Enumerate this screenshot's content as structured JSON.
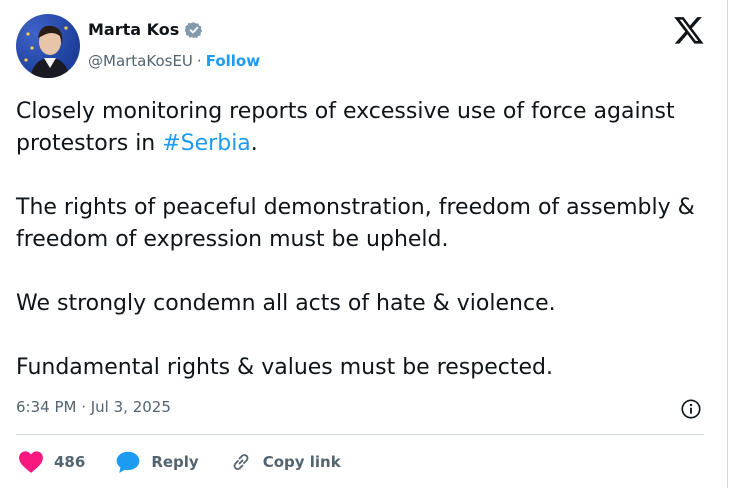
{
  "author": {
    "name": "Marta Kos",
    "handle": "@MartaKosEU",
    "separator": "·",
    "follow_label": "Follow"
  },
  "tweet": {
    "line1_prefix": "Closely monitoring reports of excessive use of force against protestors in ",
    "hashtag": "#Serbia",
    "line1_suffix": ".",
    "para2": "The rights of peaceful demonstration, freedom of assembly & freedom of expression must be upheld.",
    "para3": "We strongly condemn all acts of hate & violence.",
    "para4": "Fundamental rights & values must be respected."
  },
  "meta": {
    "timestamp": "6:34 PM · Jul 3, 2025"
  },
  "actions": {
    "likes_count": "486",
    "reply_label": "Reply",
    "copy_link_label": "Copy link"
  },
  "colors": {
    "accent": "#1d9bf0",
    "heart": "#f91880",
    "text": "#0f1419",
    "muted": "#536471"
  },
  "icons": [
    "verified-badge-icon",
    "x-logo-icon",
    "info-icon",
    "heart-icon",
    "reply-bubble-icon",
    "link-icon"
  ]
}
